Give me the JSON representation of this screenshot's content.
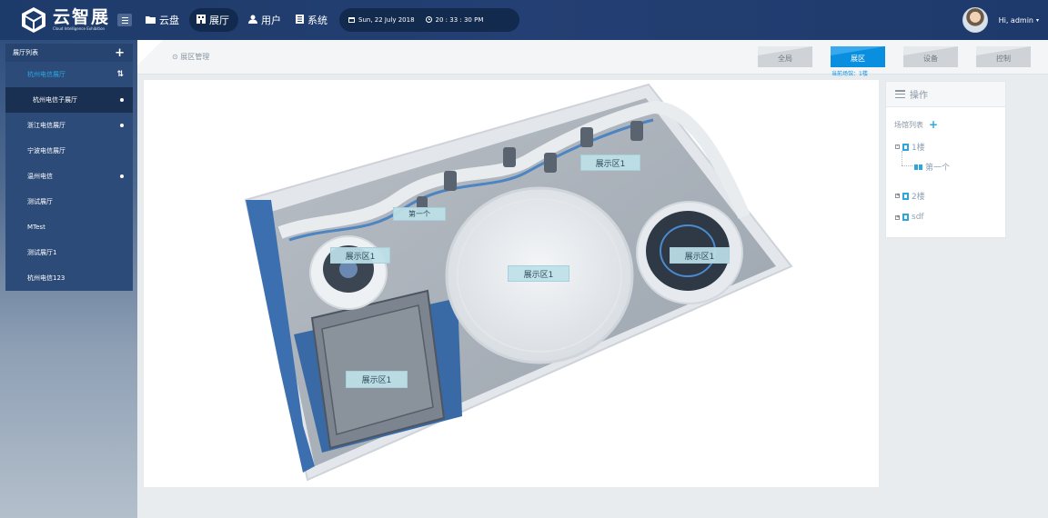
{
  "app": {
    "name_cn": "云智展",
    "name_en": "Cloud Intelligence Exhibition"
  },
  "nav": {
    "items": [
      {
        "label": "云盘",
        "icon": "folder-icon"
      },
      {
        "label": "展厅",
        "icon": "building-icon",
        "active": true
      },
      {
        "label": "用户",
        "icon": "user-icon"
      },
      {
        "label": "系统",
        "icon": "document-icon"
      }
    ],
    "date": "Sun, 22 July 2018",
    "time": "20 : 33 : 30 PM"
  },
  "user": {
    "greeting": "Hi, admin"
  },
  "sidebar": {
    "title": "展厅列表",
    "items": [
      {
        "label": "杭州电信展厅",
        "state": "current",
        "marker": "sort"
      },
      {
        "label": "杭州电信子展厅",
        "state": "sub",
        "marker": "dot"
      },
      {
        "label": "浙江电信展厅",
        "state": "normal",
        "marker": "dot"
      },
      {
        "label": "宁波电信展厅",
        "state": "normal",
        "marker": "none"
      },
      {
        "label": "温州电信",
        "state": "normal",
        "marker": "dot"
      },
      {
        "label": "测试展厅",
        "state": "normal",
        "marker": "none"
      },
      {
        "label": "MTest",
        "state": "normal",
        "marker": "none"
      },
      {
        "label": "测试展厅1",
        "state": "normal",
        "marker": "none"
      },
      {
        "label": "杭州电信123",
        "state": "normal",
        "marker": "none"
      }
    ]
  },
  "breadcrumb": "展区管理",
  "tabs": {
    "items": [
      {
        "label": "全局",
        "active": false
      },
      {
        "label": "展区",
        "active": true
      },
      {
        "label": "设备",
        "active": false
      },
      {
        "label": "控制",
        "active": false
      }
    ],
    "scene_hint": "当前场馆：1楼"
  },
  "floorplan": {
    "zones": [
      {
        "label": "展示区1",
        "name": "zone-label-top-right"
      },
      {
        "label": "第一个",
        "name": "zone-label-first"
      },
      {
        "label": "展示区1",
        "name": "zone-label-left-round"
      },
      {
        "label": "展示区1",
        "name": "zone-label-center-round"
      },
      {
        "label": "展示区1",
        "name": "zone-label-right-round"
      },
      {
        "label": "展示区1",
        "name": "zone-label-bottom-square"
      }
    ]
  },
  "ops": {
    "title": "操作",
    "venue_list": "场馆列表",
    "tree": [
      {
        "label": "1楼",
        "children": [
          {
            "label": "第一个"
          }
        ]
      },
      {
        "label": "2楼",
        "children": []
      },
      {
        "label": "sdf",
        "children": []
      }
    ]
  },
  "colors": {
    "navbar": "#1d3b6a",
    "accent": "#0a8fe0",
    "sidebar_current": "#29a8e4"
  }
}
